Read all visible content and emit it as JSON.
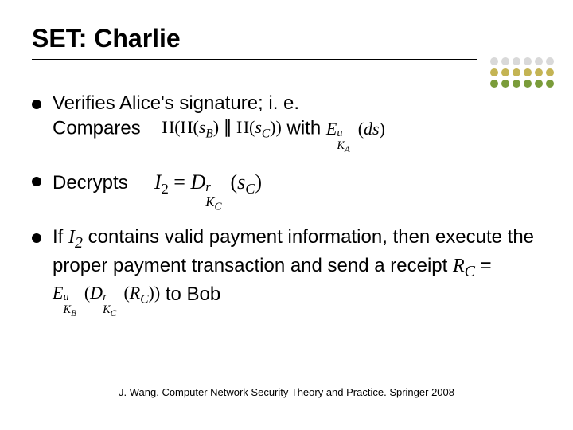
{
  "title": "SET: Charlie",
  "bullets": {
    "b1": {
      "line1": "Verifies Alice's signature; i. e.",
      "line2_pre": "Compares",
      "line2_math": "H(H(s_B) ∥ H(s_C))",
      "line2_mid": " with ",
      "line2_math2": "E_{K_A^u}(ds)"
    },
    "b2": {
      "text": "Decrypts",
      "math": "I_2 = D_{K_C^r}(s_C)"
    },
    "b3": {
      "line1_pre": "If ",
      "line1_var": "I_2",
      "line1_post": " contains valid payment information, then execute the proper payment transaction and send a receipt ",
      "rc": "R_C",
      "eq": " = ",
      "math": "E_{K_B^u}(D_{K_C^r}(R_C))",
      "tail": " to Bob"
    }
  },
  "footer": "J. Wang. Computer Network Security Theory and Practice. Springer 2008",
  "chart_data": null
}
